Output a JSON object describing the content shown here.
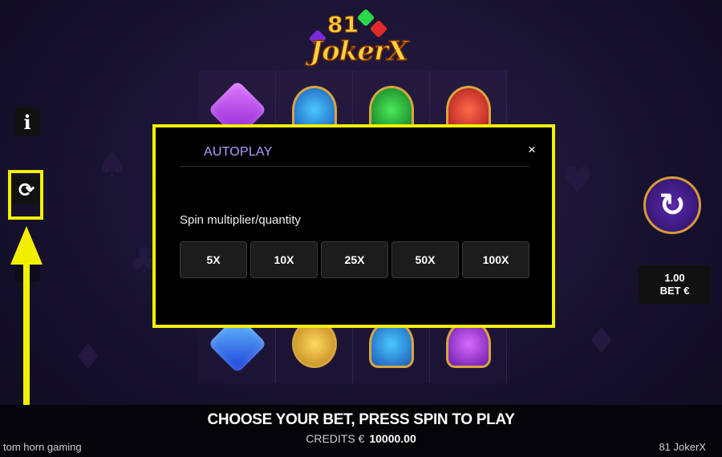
{
  "game": {
    "logo_number": "81",
    "logo_name": "JokerX"
  },
  "modal": {
    "title": "AUTOPLAY",
    "close": "×",
    "label": "Spin multiplier/quantity",
    "options": [
      "5X",
      "10X",
      "25X",
      "50X",
      "100X"
    ]
  },
  "side": {
    "info_glyph": "i",
    "autoplay_glyph": "⟳"
  },
  "spin": {
    "glyph": "↻"
  },
  "bet": {
    "value": "1.00",
    "label": "BET €"
  },
  "footer": {
    "prompt": "CHOOSE YOUR BET, PRESS SPIN TO PLAY",
    "credits_label": "CREDITS €",
    "credits_value": "10000.00",
    "brand": "tom horn gaming",
    "game_name": "81 JokerX"
  },
  "colors": {
    "highlight": "#f2f000",
    "modal_title": "#b79cff",
    "spin_button": "#3d1a80"
  }
}
